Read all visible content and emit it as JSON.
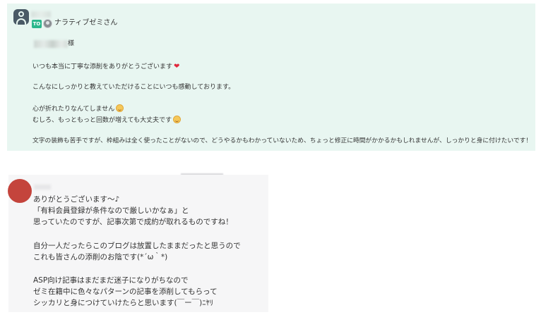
{
  "message1": {
    "to_badge": "TO",
    "to_name": "ナラティブゼミさん",
    "salutation_suffix": "様",
    "lines": [
      "いつも本当に丁寧な添削をありがとうございます",
      "こんなにしっかりと教えていただけることにいつも感動しております。",
      "心が折れたりなんてしません",
      "むしろ、もっともっと回数が増えても大丈夫です",
      "文字の装飾も苦手ですが、枠組みは全く使ったことがないので、どうやるかもわかっていないため、ちょっと修正に時間がかかるかもしれませんが、しっかりと身に付けたいです！"
    ],
    "heart_icon": "red-heart-icon",
    "emoji_icon": "smiling-face-icon"
  },
  "message2": {
    "lines": [
      "ありがとうございます～♪",
      "「有料会員登録が条件なので厳しいかなぁ」と",
      "思っていたのですが、記事次第で成約が取れるものですね！",
      "自分一人だったらこのブログは放置したままだったと思うので",
      "これも皆さんの添削のお陰です(*´ω｀*)",
      "ASP向け記事はまだまだ迷子になりがちなので",
      "ゼミ在籍中に色々なパターンの記事を添削してもらって",
      "シッカリと身につけていけたらと思います(￣ー￣)ﾆﾔﾘ"
    ]
  },
  "colors": {
    "panel1_bg": "#e8f6f1",
    "panel2_bg": "#f6f6f7",
    "to_badge": "#2bb78c",
    "avatar_red": "#c4443c"
  }
}
